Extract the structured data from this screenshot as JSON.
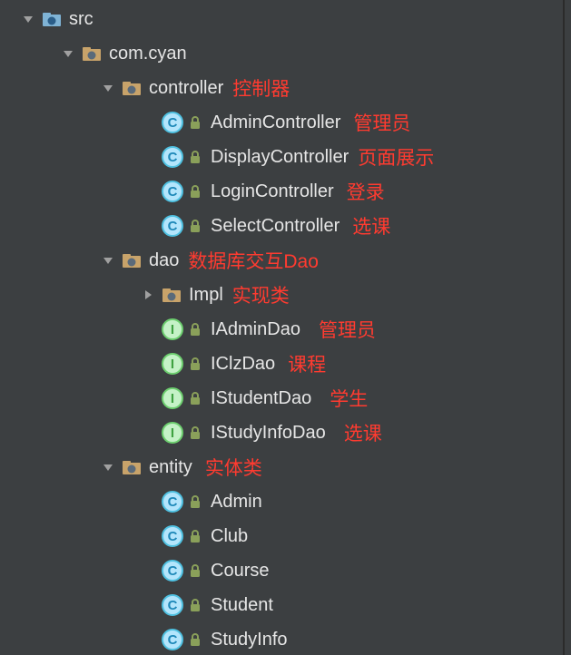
{
  "tree": {
    "src": "src",
    "pkg": "com.cyan",
    "controller": {
      "label": "controller",
      "ann": "控制器",
      "items": [
        {
          "name": "AdminController",
          "ann": "管理员"
        },
        {
          "name": "DisplayController",
          "ann": "页面展示"
        },
        {
          "name": "LoginController",
          "ann": "登录"
        },
        {
          "name": "SelectController",
          "ann": "选课"
        }
      ]
    },
    "dao": {
      "label": "dao",
      "ann": "数据库交互Dao",
      "impl": {
        "label": "Impl",
        "ann": "实现类"
      },
      "items": [
        {
          "name": "IAdminDao",
          "ann": "管理员"
        },
        {
          "name": "IClzDao",
          "ann": "课程"
        },
        {
          "name": "IStudentDao",
          "ann": "学生"
        },
        {
          "name": "IStudyInfoDao",
          "ann": "选课"
        }
      ]
    },
    "entity": {
      "label": "entity",
      "ann": "实体类",
      "items": [
        {
          "name": "Admin"
        },
        {
          "name": "Club"
        },
        {
          "name": "Course"
        },
        {
          "name": "Student"
        },
        {
          "name": "StudyInfo"
        }
      ]
    }
  }
}
